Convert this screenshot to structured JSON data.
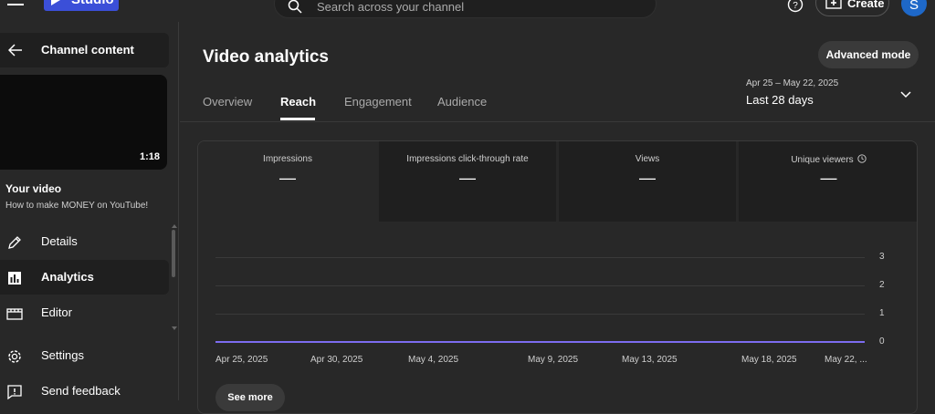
{
  "topbar": {
    "logo_text": "Studio",
    "search_placeholder": "Search across your channel",
    "create_label": "Create",
    "avatar_letter": "S"
  },
  "sidebar": {
    "channel_content_label": "Channel content",
    "thumbnail_duration": "1:18",
    "your_video_label": "Your video",
    "video_title": "How to make MONEY on YouTube!",
    "items": [
      {
        "label": "Details",
        "icon": "pencil-icon",
        "active": false
      },
      {
        "label": "Analytics",
        "icon": "analytics-icon",
        "active": true
      },
      {
        "label": "Editor",
        "icon": "editor-icon",
        "active": false
      },
      {
        "label": "Settings",
        "icon": "gear-icon",
        "active": false
      },
      {
        "label": "Send feedback",
        "icon": "feedback-icon",
        "active": false
      }
    ]
  },
  "main": {
    "title": "Video analytics",
    "advanced_mode_label": "Advanced mode",
    "tabs": [
      {
        "label": "Overview",
        "active": false
      },
      {
        "label": "Reach",
        "active": true
      },
      {
        "label": "Engagement",
        "active": false
      },
      {
        "label": "Audience",
        "active": false
      }
    ],
    "date_range": "Apr 25 – May 22, 2025",
    "date_label": "Last 28 days",
    "metrics": [
      {
        "label": "Impressions",
        "value": "—"
      },
      {
        "label": "Impressions click-through rate",
        "value": "—"
      },
      {
        "label": "Views",
        "value": "—"
      },
      {
        "label": "Unique viewers",
        "value": "—"
      }
    ],
    "see_more_label": "See more"
  },
  "chart_data": {
    "type": "line",
    "x": [
      "Apr 25, 2025",
      "Apr 30, 2025",
      "May 4, 2025",
      "May 9, 2025",
      "May 13, 2025",
      "May 18, 2025",
      "May 22, ..."
    ],
    "y_ticks": [
      "3",
      "2",
      "1",
      "0"
    ],
    "ylim": [
      0,
      3
    ],
    "series": [
      {
        "values": [
          0,
          0,
          0,
          0,
          0,
          0,
          0
        ]
      }
    ],
    "grid": true,
    "colors": {
      "line": "#7c6cf0"
    }
  }
}
